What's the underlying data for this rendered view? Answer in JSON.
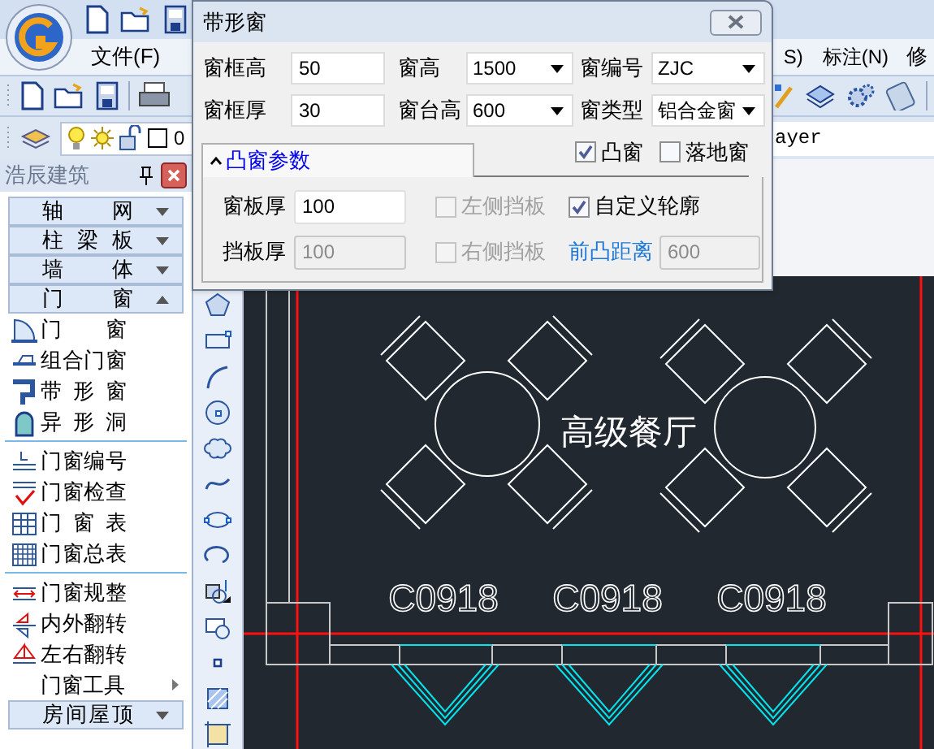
{
  "menu": [
    "文件(F)",
    "S)",
    "标注(N)",
    "修"
  ],
  "layer_toolbar": {
    "layer": "0",
    "layer_text": "ayer"
  },
  "panel": {
    "title": "浩辰建筑",
    "items": [
      {
        "kind": "header",
        "label": "轴 网",
        "expanded": false
      },
      {
        "kind": "header",
        "label": "柱 梁 板",
        "expanded": false
      },
      {
        "kind": "header",
        "label": "墙 体",
        "expanded": false
      },
      {
        "kind": "header",
        "label": "门 窗",
        "expanded": true
      },
      {
        "kind": "item",
        "label": "门 窗"
      },
      {
        "kind": "item",
        "label": "组合门窗"
      },
      {
        "kind": "item",
        "label": "带 形 窗"
      },
      {
        "kind": "item",
        "label": "异 形 洞"
      },
      {
        "kind": "divider"
      },
      {
        "kind": "item",
        "label": "门窗编号"
      },
      {
        "kind": "item",
        "label": "门窗检查"
      },
      {
        "kind": "item",
        "label": "门 窗 表"
      },
      {
        "kind": "item",
        "label": "门窗总表"
      },
      {
        "kind": "divider"
      },
      {
        "kind": "item",
        "label": "门窗规整"
      },
      {
        "kind": "item",
        "label": "内外翻转"
      },
      {
        "kind": "item",
        "label": "左右翻转"
      },
      {
        "kind": "submenu",
        "label": "门窗工具"
      },
      {
        "kind": "header",
        "label": "房间屋顶",
        "expanded": false
      }
    ]
  },
  "dialog": {
    "title": "带形窗",
    "fields": [
      {
        "label": "窗框高",
        "kind": "input",
        "value": "50"
      },
      {
        "label": "窗高",
        "kind": "select",
        "value": "1500"
      },
      {
        "label": "窗编号",
        "kind": "select",
        "value": "ZJC"
      },
      {
        "label": "窗框厚",
        "kind": "input",
        "value": "30"
      },
      {
        "label": "窗台高",
        "kind": "select",
        "value": "600"
      },
      {
        "label": "窗类型",
        "kind": "select",
        "value": "铝合金窗"
      }
    ],
    "section": {
      "label": "凸窗参数",
      "expanded": true
    },
    "options": [
      {
        "label": "凸窗",
        "checked": true,
        "disabled": false
      },
      {
        "label": "落地窗",
        "checked": false,
        "disabled": false
      }
    ],
    "params": [
      {
        "label": "窗板厚",
        "value": "100",
        "disabled": false
      },
      {
        "label": "挡板厚",
        "value": "100",
        "disabled": true
      }
    ],
    "checks": [
      {
        "label": "左侧挡板",
        "checked": false,
        "disabled": true
      },
      {
        "label": "自定义轮廓",
        "checked": true,
        "disabled": false
      },
      {
        "label": "右侧挡板",
        "checked": false,
        "disabled": true
      }
    ],
    "offset": {
      "label": "前凸距离",
      "value": "600",
      "disabled": true
    }
  },
  "canvas": {
    "room_label": "高级餐厅",
    "window_labels": [
      "C0918",
      "C0918",
      "C0918"
    ]
  }
}
